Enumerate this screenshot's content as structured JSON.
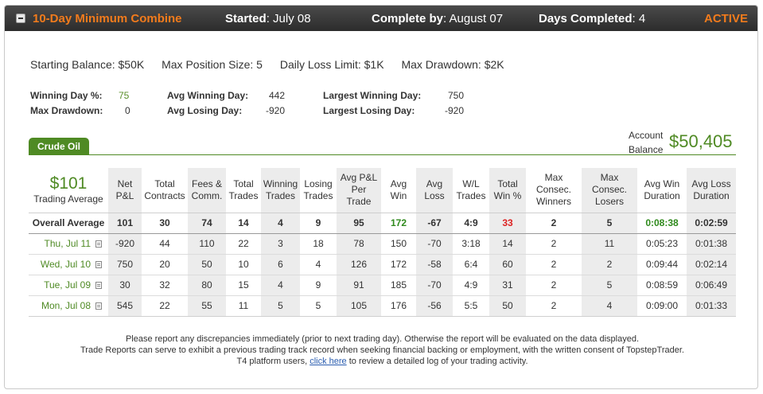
{
  "header": {
    "title": "10-Day Minimum Combine",
    "started_label": "Started",
    "started_value": ": July 08",
    "complete_label": "Complete by",
    "complete_value": ": August 07",
    "days_label": "Days Completed",
    "days_value": ": 4",
    "status": "ACTIVE"
  },
  "limits": {
    "starting_balance": "Starting Balance: $50K",
    "max_position": "Max Position Size: 5",
    "daily_loss": "Daily Loss Limit: $1K",
    "max_drawdown": "Max Drawdown: $2K"
  },
  "stats": {
    "winning_day_pct_label": "Winning Day %:",
    "winning_day_pct": "75",
    "max_drawdown_label": "Max Drawdown:",
    "max_drawdown": "0",
    "avg_winning_day_label": "Avg Winning Day:",
    "avg_winning_day": "442",
    "avg_losing_day_label": "Avg Losing Day:",
    "avg_losing_day": "-920",
    "largest_winning_day_label": "Largest Winning Day:",
    "largest_winning_day": "750",
    "largest_losing_day_label": "Largest Losing Day:",
    "largest_losing_day": "-920"
  },
  "tab": {
    "label": "Crude Oil"
  },
  "account": {
    "label_line1": "Account",
    "label_line2": "Balance",
    "value": "$50,405"
  },
  "table": {
    "trading_average_value": "$101",
    "trading_average_label": "Trading Average",
    "headers": {
      "net_pl": [
        "Net",
        "P&L"
      ],
      "total_contracts": [
        "Total",
        "Contracts"
      ],
      "fees": [
        "Fees &",
        "Comm."
      ],
      "total_trades": [
        "Total",
        "Trades"
      ],
      "winning_trades": [
        "Winning",
        "Trades"
      ],
      "losing_trades": [
        "Losing",
        "Trades"
      ],
      "avg_pl_per_trade": [
        "Avg P&L",
        "Per",
        "Trade"
      ],
      "avg_win": [
        "Avg",
        "Win"
      ],
      "avg_loss": [
        "Avg",
        "Loss"
      ],
      "wl_trades": [
        "W/L",
        "Trades"
      ],
      "total_win_pct": [
        "Total",
        "Win %"
      ],
      "max_consec_winners": [
        "Max Consec.",
        "Winners"
      ],
      "max_consec_losers": [
        "Max Consec.",
        "Losers"
      ],
      "avg_win_duration": [
        "Avg Win",
        "Duration"
      ],
      "avg_loss_duration": [
        "Avg Loss",
        "Duration"
      ]
    },
    "overall": {
      "label": "Overall Average",
      "net_pl": "101",
      "total_contracts": "30",
      "fees": "74",
      "total_trades": "14",
      "winning_trades": "4",
      "losing_trades": "9",
      "avg_pl_per_trade": "95",
      "avg_win": "172",
      "avg_loss": "-67",
      "wl_trades": "4:9",
      "total_win_pct": "33",
      "max_consec_winners": "2",
      "max_consec_losers": "5",
      "avg_win_duration": "0:08:38",
      "avg_loss_duration": "0:02:59"
    },
    "rows": [
      {
        "date": "Thu, Jul 11",
        "net_pl": "-920",
        "total_contracts": "44",
        "fees": "110",
        "total_trades": "22",
        "winning_trades": "3",
        "losing_trades": "18",
        "avg_pl_per_trade": "78",
        "avg_win": "150",
        "avg_loss": "-70",
        "wl_trades": "3:18",
        "total_win_pct": "14",
        "max_consec_winners": "2",
        "max_consec_losers": "11",
        "avg_win_duration": "0:05:23",
        "avg_loss_duration": "0:01:38"
      },
      {
        "date": "Wed, Jul 10",
        "net_pl": "750",
        "total_contracts": "20",
        "fees": "50",
        "total_trades": "10",
        "winning_trades": "6",
        "losing_trades": "4",
        "avg_pl_per_trade": "126",
        "avg_win": "172",
        "avg_loss": "-58",
        "wl_trades": "6:4",
        "total_win_pct": "60",
        "max_consec_winners": "2",
        "max_consec_losers": "2",
        "avg_win_duration": "0:09:44",
        "avg_loss_duration": "0:02:14"
      },
      {
        "date": "Tue, Jul 09",
        "net_pl": "30",
        "total_contracts": "32",
        "fees": "80",
        "total_trades": "15",
        "winning_trades": "4",
        "losing_trades": "9",
        "avg_pl_per_trade": "91",
        "avg_win": "185",
        "avg_loss": "-70",
        "wl_trades": "4:9",
        "total_win_pct": "31",
        "max_consec_winners": "2",
        "max_consec_losers": "5",
        "avg_win_duration": "0:08:59",
        "avg_loss_duration": "0:06:49"
      },
      {
        "date": "Mon, Jul 08",
        "net_pl": "545",
        "total_contracts": "22",
        "fees": "55",
        "total_trades": "11",
        "winning_trades": "5",
        "losing_trades": "5",
        "avg_pl_per_trade": "105",
        "avg_win": "176",
        "avg_loss": "-56",
        "wl_trades": "5:5",
        "total_win_pct": "50",
        "max_consec_winners": "2",
        "max_consec_losers": "4",
        "avg_win_duration": "0:09:00",
        "avg_loss_duration": "0:01:33"
      }
    ]
  },
  "footer": {
    "line1": "Please report any discrepancies immediately (prior to next trading day). Otherwise the report will be evaluated on the data displayed.",
    "line2": "Trade Reports can serve to exhibit a previous trading track record when seeking financial backing or employment, with the written consent of TopstepTrader.",
    "line3_prefix": "T4 platform users, ",
    "line3_link": "click here",
    "line3_suffix": " to review a detailed log of your trading activity."
  }
}
